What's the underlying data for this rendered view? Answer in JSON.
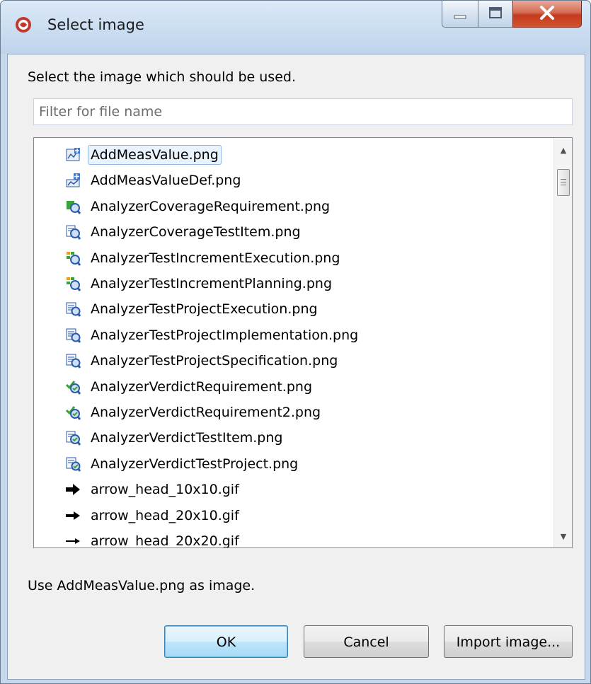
{
  "window": {
    "title": "Select image",
    "controls": [
      "minimize",
      "maximize",
      "close"
    ],
    "accent_close": "#c8432a",
    "title_gradient": "#c9dcf0"
  },
  "prompt": "Select the image which should be used.",
  "filter": {
    "placeholder": "Filter for file name",
    "value": ""
  },
  "list": {
    "items": [
      {
        "label": "AddMeasValue.png",
        "icon": "meas-value-icon",
        "selected": true
      },
      {
        "label": "AddMeasValueDef.png",
        "icon": "meas-value-def-icon",
        "selected": false
      },
      {
        "label": "AnalyzerCoverageRequirement.png",
        "icon": "analyzer-requirement-icon",
        "selected": false
      },
      {
        "label": "AnalyzerCoverageTestItem.png",
        "icon": "analyzer-testitem-icon",
        "selected": false
      },
      {
        "label": "AnalyzerTestIncrementExecution.png",
        "icon": "analyzer-increment-icon",
        "selected": false
      },
      {
        "label": "AnalyzerTestIncrementPlanning.png",
        "icon": "analyzer-increment-icon",
        "selected": false
      },
      {
        "label": "AnalyzerTestProjectExecution.png",
        "icon": "analyzer-project-icon",
        "selected": false
      },
      {
        "label": "AnalyzerTestProjectImplementation.png",
        "icon": "analyzer-project-icon",
        "selected": false
      },
      {
        "label": "AnalyzerTestProjectSpecification.png",
        "icon": "analyzer-project-icon",
        "selected": false
      },
      {
        "label": "AnalyzerVerdictRequirement.png",
        "icon": "analyzer-verdict-icon",
        "selected": false
      },
      {
        "label": "AnalyzerVerdictRequirement2.png",
        "icon": "analyzer-verdict-icon",
        "selected": false
      },
      {
        "label": "AnalyzerVerdictTestItem.png",
        "icon": "analyzer-verdict-testitem-icon",
        "selected": false
      },
      {
        "label": "AnalyzerVerdictTestProject.png",
        "icon": "analyzer-verdict-project-icon",
        "selected": false
      },
      {
        "label": "arrow_head_10x10.gif",
        "icon": "arrow-bold-icon",
        "selected": false
      },
      {
        "label": "arrow_head_20x10.gif",
        "icon": "arrow-medium-icon",
        "selected": false
      },
      {
        "label": "arrow_head_20x20.gif",
        "icon": "arrow-thin-icon",
        "selected": false
      }
    ]
  },
  "status": "Use AddMeasValue.png as image.",
  "buttons": {
    "ok": "OK",
    "cancel": "Cancel",
    "import": "Import image..."
  }
}
